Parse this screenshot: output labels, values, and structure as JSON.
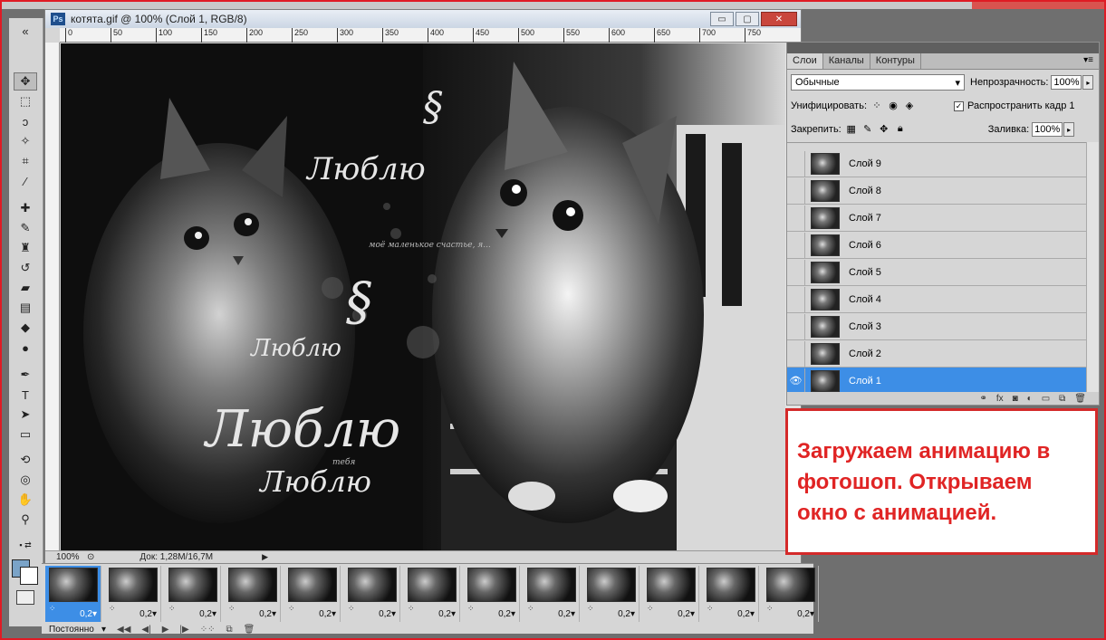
{
  "document": {
    "app_badge": "Ps",
    "title": "котята.gif @ 100% (Слой 1, RGB/8)",
    "minimize": "▭",
    "restore": "▢",
    "close": "✕",
    "zoom": "100%",
    "doc_info": "Док: 1,28М/16,7М",
    "ruler_ticks": [
      "0",
      "50",
      "100",
      "150",
      "200",
      "250",
      "300",
      "350",
      "400",
      "450",
      "500",
      "550",
      "600",
      "650",
      "700",
      "750"
    ]
  },
  "canvas_text": {
    "lyublyu_1": "Люблю",
    "lyublyu_2": "Люблю",
    "lyublyu_3": "Люблю",
    "lyublyu_4": "Люблю",
    "tebya": "тебя",
    "small_phrase": "моё маленькое счастье, я..."
  },
  "layers_panel": {
    "tabs": [
      "Слои",
      "Каналы",
      "Контуры"
    ],
    "blend_mode": "Обычные",
    "opacity_label": "Непрозрачность:",
    "opacity_value": "100%",
    "unify_label": "Унифицировать:",
    "propagate_label": "Распространить кадр 1",
    "lock_label": "Закрепить:",
    "fill_label": "Заливка:",
    "fill_value": "100%",
    "layers": [
      "Слой 9",
      "Слой 8",
      "Слой 7",
      "Слой 6",
      "Слой 5",
      "Слой 4",
      "Слой 3",
      "Слой 2",
      "Слой 1"
    ],
    "selected_layer": "Слой 1"
  },
  "note": {
    "text": "Загружаем анимацию в фотошоп. Открываем окно с анимацией."
  },
  "animation": {
    "frame_delay": "0,2▾",
    "frame_count": 13,
    "loop": "Постоянно"
  },
  "colors": {
    "accent_red": "#e02424",
    "selection_blue": "#3d8ee6"
  }
}
